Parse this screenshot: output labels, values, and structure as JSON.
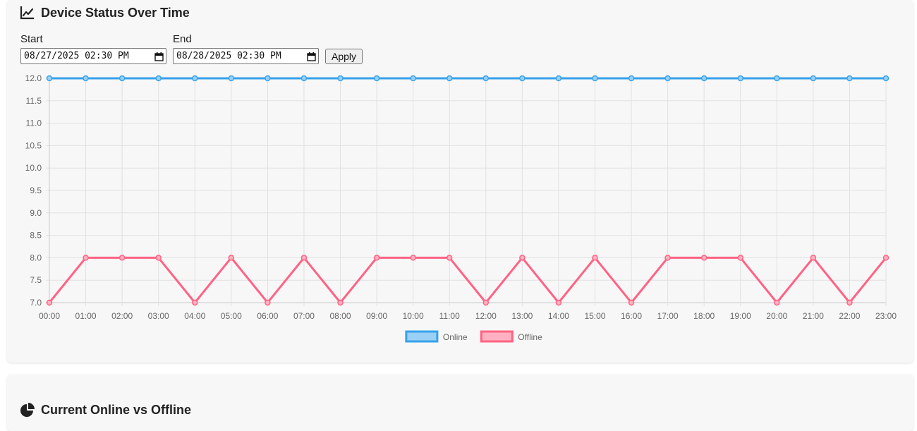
{
  "status_card": {
    "title": "Device Status Over Time",
    "title_icon": "line-chart-icon",
    "start_label": "Start",
    "end_label": "End",
    "start_value": "08/27/2025 02:30 PM",
    "end_value": "08/28/2025 02:30 PM",
    "apply_label": "Apply"
  },
  "current_card": {
    "title": "Current Online vs Offline",
    "title_icon": "pie-chart-icon"
  },
  "chart_data": {
    "type": "line",
    "x": [
      "00:00",
      "01:00",
      "02:00",
      "03:00",
      "04:00",
      "05:00",
      "06:00",
      "07:00",
      "08:00",
      "09:00",
      "10:00",
      "11:00",
      "12:00",
      "13:00",
      "14:00",
      "15:00",
      "16:00",
      "17:00",
      "18:00",
      "19:00",
      "20:00",
      "21:00",
      "22:00",
      "23:00"
    ],
    "series": [
      {
        "name": "Online",
        "color": "#36a2eb",
        "fill": "#9ad0f5",
        "values": [
          12,
          12,
          12,
          12,
          12,
          12,
          12,
          12,
          12,
          12,
          12,
          12,
          12,
          12,
          12,
          12,
          12,
          12,
          12,
          12,
          12,
          12,
          12,
          12
        ]
      },
      {
        "name": "Offline",
        "color": "#ff6384",
        "fill": "#ffb1c1",
        "values": [
          7,
          8,
          8,
          8,
          7,
          8,
          7,
          8,
          7,
          8,
          8,
          8,
          7,
          8,
          7,
          8,
          7,
          8,
          8,
          8,
          7,
          8,
          7,
          8
        ]
      }
    ],
    "ylim": [
      7.0,
      12.0
    ],
    "yticks": [
      "7.0",
      "7.5",
      "8.0",
      "8.5",
      "9.0",
      "9.5",
      "10.0",
      "10.5",
      "11.0",
      "11.5",
      "12.0"
    ],
    "grid": true,
    "legend": "bottom-center",
    "title": "",
    "xlabel": "",
    "ylabel": ""
  }
}
